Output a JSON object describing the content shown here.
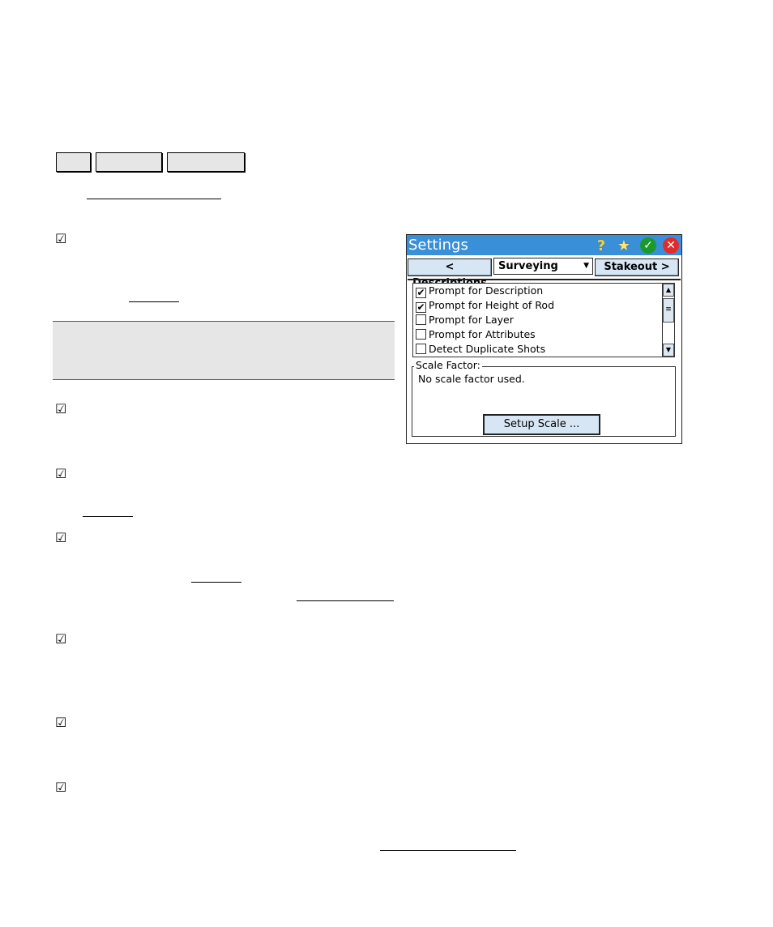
{
  "page": {
    "checkmark": "☑"
  },
  "settings": {
    "title": "Settings",
    "icons": [
      "help-icon",
      "favorites-star-icon",
      "ok-icon",
      "close-icon"
    ],
    "prev_button": "< Descriptions",
    "dropdown_value": "Surveying",
    "next_button": "Stakeout >",
    "options": [
      {
        "label": "Prompt for Description",
        "checked": true
      },
      {
        "label": "Prompt for Height of Rod",
        "checked": true
      },
      {
        "label": "Prompt for Layer",
        "checked": false
      },
      {
        "label": "Prompt for Attributes",
        "checked": false
      },
      {
        "label": "Detect Duplicate Shots",
        "checked": false
      }
    ],
    "scale_group_label": "Scale Factor:",
    "scale_text": "No scale factor used.",
    "setup_button": "Setup Scale ..."
  },
  "colors": {
    "titlebar": "#3a8fd9",
    "button_fill": "#d6e6f5",
    "note_fill": "#e6e6e6"
  }
}
